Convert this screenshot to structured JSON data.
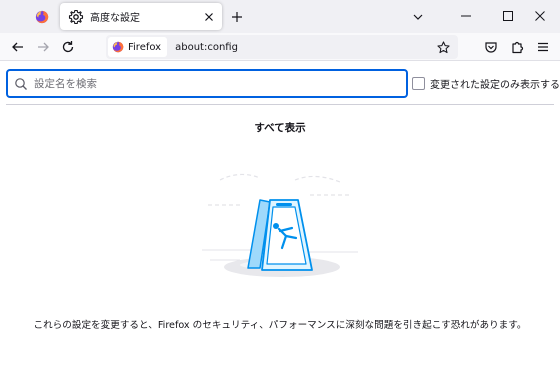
{
  "tabs": [
    {
      "title": "高度な設定",
      "icon": "gear-icon"
    }
  ],
  "nav": {
    "identity_label": "Firefox",
    "url": "about:config"
  },
  "search": {
    "placeholder": "設定名を検索",
    "value": ""
  },
  "filter": {
    "label": "変更された設定のみ表示する",
    "checked": false
  },
  "content": {
    "show_all": "すべて表示",
    "warning": "これらの設定を変更すると、Firefox のセキュリティ、パフォーマンスに深刻な問題を引き起こす恐れがあります。"
  },
  "colors": {
    "accent": "#0061e0",
    "illustration_blue": "#0090ed",
    "illustration_light": "#e0f5ff"
  }
}
